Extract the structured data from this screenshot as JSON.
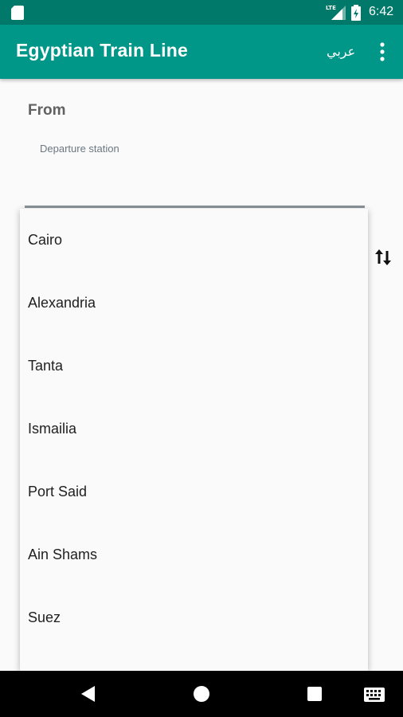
{
  "status_bar": {
    "time": "6:42",
    "network": "LTE",
    "icons": [
      "sd-card-icon",
      "signal-icon",
      "battery-icon"
    ]
  },
  "app_bar": {
    "title": "Egyptian Train Line",
    "language_button": "عربي",
    "menu_icon": "overflow-menu-icon"
  },
  "form": {
    "from_label": "From",
    "departure_hint": "Departure station",
    "swap_icon": "swap-vertical-icon"
  },
  "dropdown": {
    "items": [
      "Cairo",
      "Alexandria",
      "Tanta",
      "Ismailia",
      "Port Said",
      "Ain Shams",
      "Suez"
    ]
  },
  "nav_bar": {
    "icons": [
      "back-icon",
      "home-icon",
      "recents-icon",
      "keyboard-icon"
    ]
  },
  "colors": {
    "primary": "#009688",
    "primary_dark": "#00796b"
  }
}
